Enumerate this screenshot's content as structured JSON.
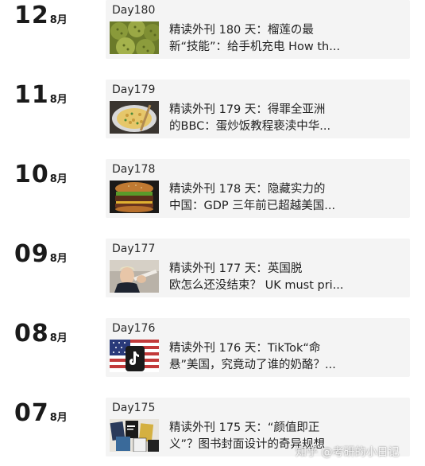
{
  "entries": [
    {
      "day": "12",
      "month": "8月",
      "label": "Day180",
      "title_line1": "精读外刊 180 天：榴莲の最",
      "title_line2": "新“技能”：给手机充电 How th...",
      "thumb": "durian-image"
    },
    {
      "day": "11",
      "month": "8月",
      "label": "Day179",
      "title_line1": "精读外刊 179 天：得罪全亚洲",
      "title_line2": "的BBC：蛋炒饭教程亵渎中华...",
      "thumb": "fried-rice-image"
    },
    {
      "day": "10",
      "month": "8月",
      "label": "Day178",
      "title_line1": "精读外刊 178 天：隐藏实力的",
      "title_line2": "中国：GDP 三年前已超越美国...",
      "thumb": "burger-image"
    },
    {
      "day": "09",
      "month": "8月",
      "label": "Day177",
      "title_line1": "精读外刊 177 天：英国脱",
      "title_line2": "欧怎么还没结束？ UK must pri...",
      "thumb": "politician-image"
    },
    {
      "day": "08",
      "month": "8月",
      "label": "Day176",
      "title_line1": "精读外刊 176 天：TikTok“命",
      "title_line2": "悬”美国，究竟动了谁的奶酪？...",
      "thumb": "tiktok-flag-image"
    },
    {
      "day": "07",
      "month": "8月",
      "label": "Day175",
      "title_line1": "精读外刊 175 天：“颜值即正",
      "title_line2": "义”？图书封面设计的奇异规想",
      "thumb": "book-covers-image"
    }
  ],
  "watermark": "知乎 @考研的小日记"
}
